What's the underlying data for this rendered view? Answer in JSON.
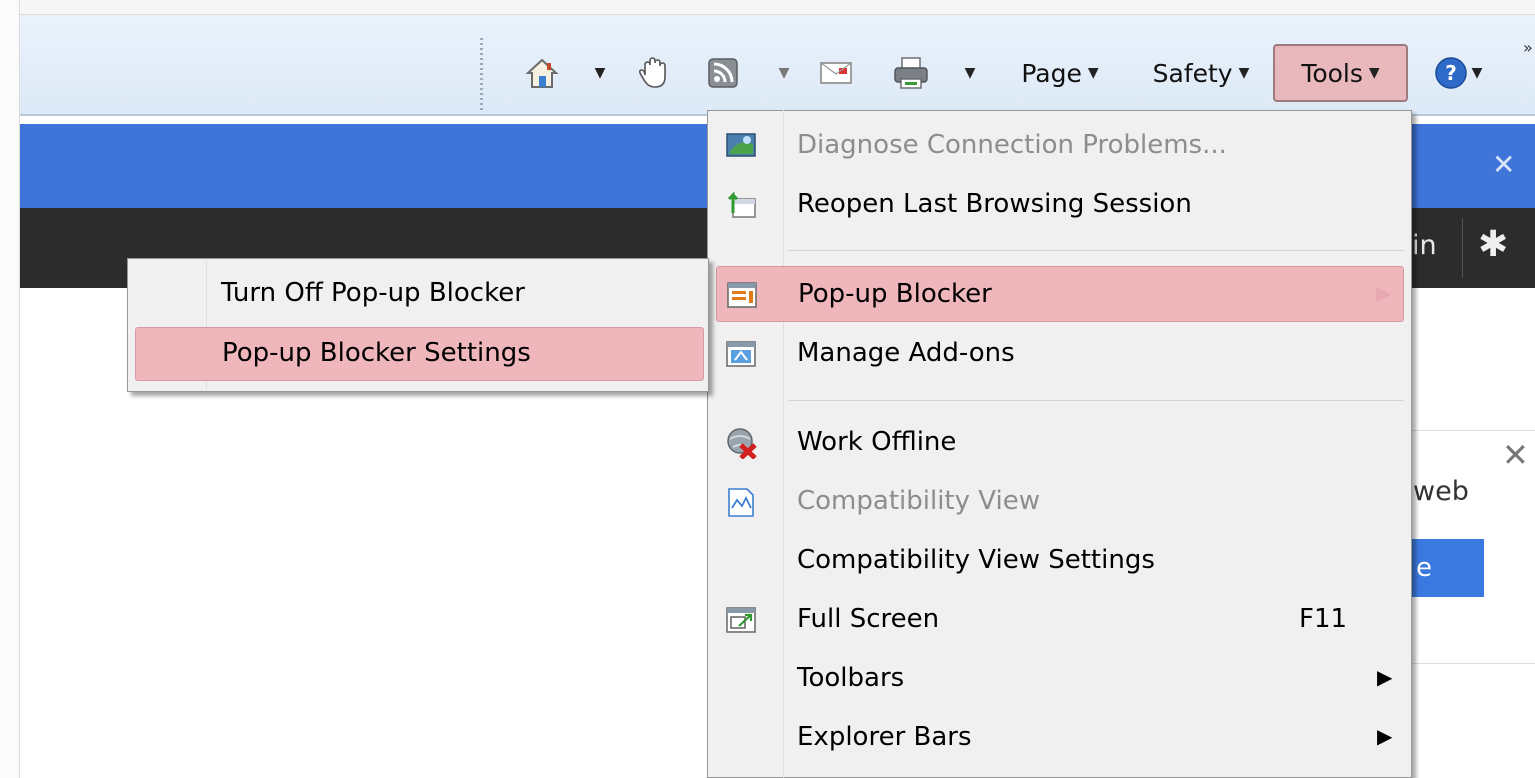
{
  "toolbar": {
    "page_label": "Page",
    "safety_label": "Safety",
    "tools_label": "Tools",
    "overflow_label": "»"
  },
  "page_background": {
    "sign_in_partial": "in",
    "notification_text_partial": "web",
    "notification_button_partial": "e"
  },
  "tools_menu": {
    "items": [
      {
        "label": "Diagnose Connection Problems...",
        "icon": "diagnose-icon",
        "disabled": true
      },
      {
        "label": "Reopen Last Browsing Session",
        "icon": "reopen-session-icon",
        "disabled": false
      },
      {
        "label": "Pop-up Blocker",
        "icon": "popup-blocker-icon",
        "disabled": false,
        "submenu": true,
        "highlighted": true
      },
      {
        "label": "Manage Add-ons",
        "icon": "manage-addons-icon",
        "disabled": false
      },
      {
        "label": "Work Offline",
        "icon": "work-offline-icon",
        "disabled": false
      },
      {
        "label": "Compatibility View",
        "icon": "compatibility-view-icon",
        "disabled": true
      },
      {
        "label": "Compatibility View Settings",
        "disabled": false
      },
      {
        "label": "Full Screen",
        "icon": "full-screen-icon",
        "shortcut": "F11",
        "disabled": false
      },
      {
        "label": "Toolbars",
        "submenu": true,
        "disabled": false
      },
      {
        "label": "Explorer Bars",
        "submenu": true,
        "disabled": false
      }
    ]
  },
  "popup_submenu": {
    "items": [
      {
        "label": "Turn Off Pop-up Blocker"
      },
      {
        "label": "Pop-up Blocker Settings",
        "highlighted": true
      }
    ]
  },
  "colors": {
    "highlight": "#efb6bc",
    "page_blue_bar": "#3f74d8",
    "page_dark_bar": "#2c2c2c",
    "toolbar_bg": "#e3edf9"
  }
}
